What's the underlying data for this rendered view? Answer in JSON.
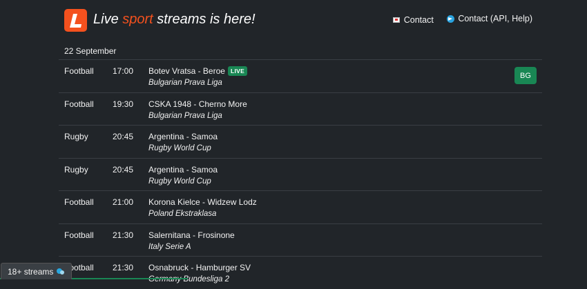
{
  "header": {
    "brand_part1": "Live ",
    "brand_accent": "sport",
    "brand_part2": " streams is here!",
    "contact_label": "Contact",
    "contact_api_label": "Contact (API, Help)"
  },
  "date": "22 September",
  "events": [
    {
      "sport": "Football",
      "time": "17:00",
      "match": "Botev Vratsa - Beroe",
      "live": "LIVE",
      "league": "Bulgarian Prava Liga",
      "lang": "BG"
    },
    {
      "sport": "Football",
      "time": "19:30",
      "match": "CSKA 1948 - Cherno More",
      "league": "Bulgarian Prava Liga"
    },
    {
      "sport": "Rugby",
      "time": "20:45",
      "match": "Argentina - Samoa",
      "league": "Rugby World Cup"
    },
    {
      "sport": "Rugby",
      "time": "20:45",
      "match": "Argentina - Samoa",
      "league": "Rugby World Cup"
    },
    {
      "sport": "Football",
      "time": "21:00",
      "match": "Korona Kielce - Widzew Lodz",
      "league": "Poland Ekstraklasa"
    },
    {
      "sport": "Football",
      "time": "21:30",
      "match": "Salernitana - Frosinone",
      "league": "Italy Serie A"
    },
    {
      "sport": "Football",
      "time": "21:30",
      "match": "Osnabruck - Hamburger SV",
      "league": "Germany Bundesliga 2"
    }
  ],
  "streams_button": "18+ streams",
  "colors": {
    "accent": "#f4511e",
    "background": "#212529",
    "live": "#198754",
    "border": "#3a3f44"
  }
}
